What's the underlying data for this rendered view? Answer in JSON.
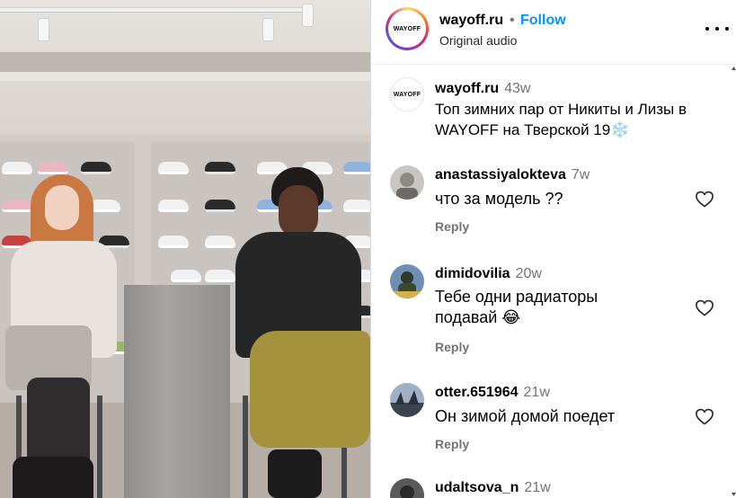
{
  "post": {
    "username": "wayoff.ru",
    "separator": "•",
    "follow_label": "Follow",
    "audio_label": "Original audio",
    "logo_text": "WAYOFF",
    "more_icon": "more-horizontal-icon"
  },
  "caption": {
    "username": "wayoff.ru",
    "time": "43w",
    "text_line1": "Топ зимних пар от Никиты и Лизы в",
    "text_line2": "WAYOFF на Тверской 19❄️"
  },
  "comments": [
    {
      "username": "anastassiyalokteva",
      "time": "7w",
      "text": "что за модель ??",
      "reply_label": "Reply",
      "avatar_color": "#8c8a84"
    },
    {
      "username": "dimidovilia",
      "time": "20w",
      "text": "Тебе одни радиаторы подавай 😂",
      "reply_label": "Reply",
      "avatar_color": "#4b6a8e"
    },
    {
      "username": "otter.651964",
      "time": "21w",
      "text": "Он зимой домой поедет",
      "reply_label": "Reply",
      "avatar_color": "#6f7b8a"
    },
    {
      "username": "udaltsova_n",
      "time": "21w",
      "text": "",
      "reply_label": "",
      "avatar_color": "#3a3a3a"
    }
  ],
  "colors": {
    "follow_blue": "#0095f6",
    "muted_gray": "#737373"
  }
}
